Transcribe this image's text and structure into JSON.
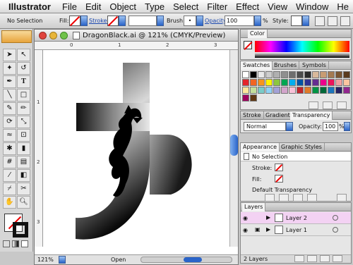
{
  "menubar": {
    "app": "Illustrator",
    "items": [
      "File",
      "Edit",
      "Object",
      "Type",
      "Select",
      "Filter",
      "Effect",
      "View",
      "Window",
      "He"
    ]
  },
  "control": {
    "selection": "No Selection",
    "fill_label": "Fill:",
    "stroke_label": "Stroke:",
    "brush_label": "Brush:",
    "brush_value": "•",
    "opacity_label": "Opacity:",
    "opacity_value": "100",
    "opacity_unit": "%",
    "style_label": "Style:"
  },
  "document": {
    "title": "DragonBlack.ai @ 121% (CMYK/Preview)",
    "ruler_top": [
      "0",
      "1",
      "2",
      "3"
    ],
    "ruler_left": [
      "1",
      "2",
      "3"
    ],
    "zoom": "121%",
    "status": "Open"
  },
  "color_panel": {
    "tab": "Color"
  },
  "swatches_panel": {
    "tabs": [
      "Swatches",
      "Brushes",
      "Symbols"
    ],
    "colors": [
      "#ffffff",
      "#000000",
      "#e9e9e9",
      "#cdcdcd",
      "#b0b0b0",
      "#8f8f8f",
      "#6e6e6e",
      "#4c4c4c",
      "#2b2b2b",
      "#d9b99b",
      "#c89c73",
      "#a47a52",
      "#7a5633",
      "#5a3b1e",
      "#e3242b",
      "#f26522",
      "#f7941d",
      "#fff200",
      "#8dc63f",
      "#00a651",
      "#00aeef",
      "#0054a6",
      "#2e3192",
      "#662d91",
      "#ec008c",
      "#ed145b",
      "#f0a0a0",
      "#fbc5a0",
      "#fde59c",
      "#c4df9b",
      "#7accc8",
      "#8fd3f5",
      "#a3a1d6",
      "#d3a5cc",
      "#f7c2d8",
      "#c1272d",
      "#e07b2a",
      "#009444",
      "#006838",
      "#1b75bc",
      "#262262",
      "#92278f",
      "#9e005d",
      "#603813"
    ]
  },
  "transparency_panel": {
    "tabs": [
      "Stroke",
      "Gradient",
      "Transparency"
    ],
    "mode": "Normal",
    "opacity_label": "Opacity:",
    "opacity_value": "100",
    "opacity_unit": "%"
  },
  "appearance_panel": {
    "tabs": [
      "Appearance",
      "Graphic Styles"
    ],
    "selection": "No Selection",
    "stroke_label": "Stroke:",
    "fill_label": "Fill:",
    "default": "Default Transparency"
  },
  "layers_panel": {
    "tab": "Layers",
    "layers": [
      "Layer 2",
      "Layer 1"
    ],
    "count": "2 Layers"
  }
}
